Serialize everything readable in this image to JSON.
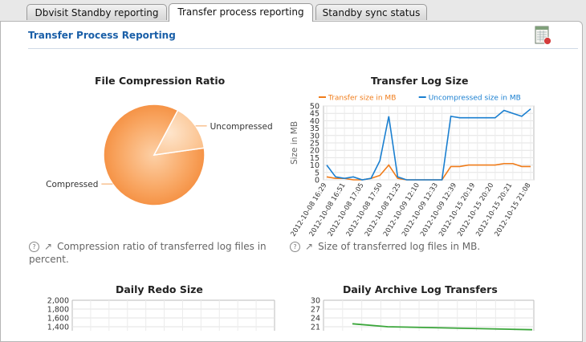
{
  "tabs": [
    {
      "label": "Dbvisit Standby reporting",
      "active": false
    },
    {
      "label": "Transfer process reporting",
      "active": true
    },
    {
      "label": "Standby sync status",
      "active": false
    }
  ],
  "panel": {
    "title": "Transfer Process Reporting"
  },
  "compression_chart": {
    "title": "File Compression Ratio",
    "help": "Compression ratio of transferred log files in percent.",
    "chart_data": {
      "type": "pie",
      "slices": [
        {
          "label": "Compressed",
          "value": 85,
          "color": "#f8a25e"
        },
        {
          "label": "Uncompressed",
          "value": 15,
          "color": "#fcc998"
        }
      ]
    }
  },
  "transfer_chart": {
    "title": "Transfer Log Size",
    "help": "Size of transferred log files in MB.",
    "chart_data": {
      "type": "line",
      "ylabel": "Size in MB",
      "ylim": [
        0,
        50
      ],
      "yticks": [
        0,
        5,
        10,
        15,
        20,
        25,
        30,
        35,
        40,
        45,
        50
      ],
      "xticks": [
        "2012-10-08 16:29",
        "2012-10-08 16:51",
        "2012-10-08 17:05",
        "2012-10-08 17:50",
        "2012-10-08 21:25",
        "2012-10-09 12:10",
        "2012-10-09 12:33",
        "2012-10-09 12:39",
        "2012-10-15 20:19",
        "2012-10-15 20:20",
        "2012-10-15 20:21",
        "2012-10-15 21:08"
      ],
      "series": [
        {
          "name": "Transfer size in MB",
          "color": "#f07c1a",
          "values": [
            2,
            1,
            1,
            0,
            0,
            1,
            3,
            10,
            1,
            0,
            0,
            0,
            0,
            0,
            9,
            9,
            10,
            10,
            10,
            10,
            11,
            11,
            9,
            9
          ]
        },
        {
          "name": "Uncompressed size in MB",
          "color": "#1a7fd0",
          "values": [
            10,
            2,
            1,
            2,
            0,
            1,
            13,
            43,
            2,
            0,
            0,
            0,
            0,
            0,
            43,
            42,
            42,
            42,
            42,
            42,
            47,
            45,
            43,
            48
          ]
        }
      ]
    }
  },
  "redo_chart": {
    "title": "Daily Redo Size",
    "chart_data": {
      "type": "line",
      "ylim": [
        0,
        2000
      ],
      "yticks": [
        "2,000",
        "1,800",
        "1,600",
        "1,400"
      ]
    }
  },
  "archive_chart": {
    "title": "Daily Archive Log Transfers",
    "chart_data": {
      "type": "line",
      "ylim": [
        0,
        30
      ],
      "yticks": [
        "30",
        "27",
        "24",
        "21"
      ],
      "series": [
        {
          "color": "#3aa63a",
          "values": [
            22,
            21,
            20
          ]
        }
      ]
    }
  }
}
